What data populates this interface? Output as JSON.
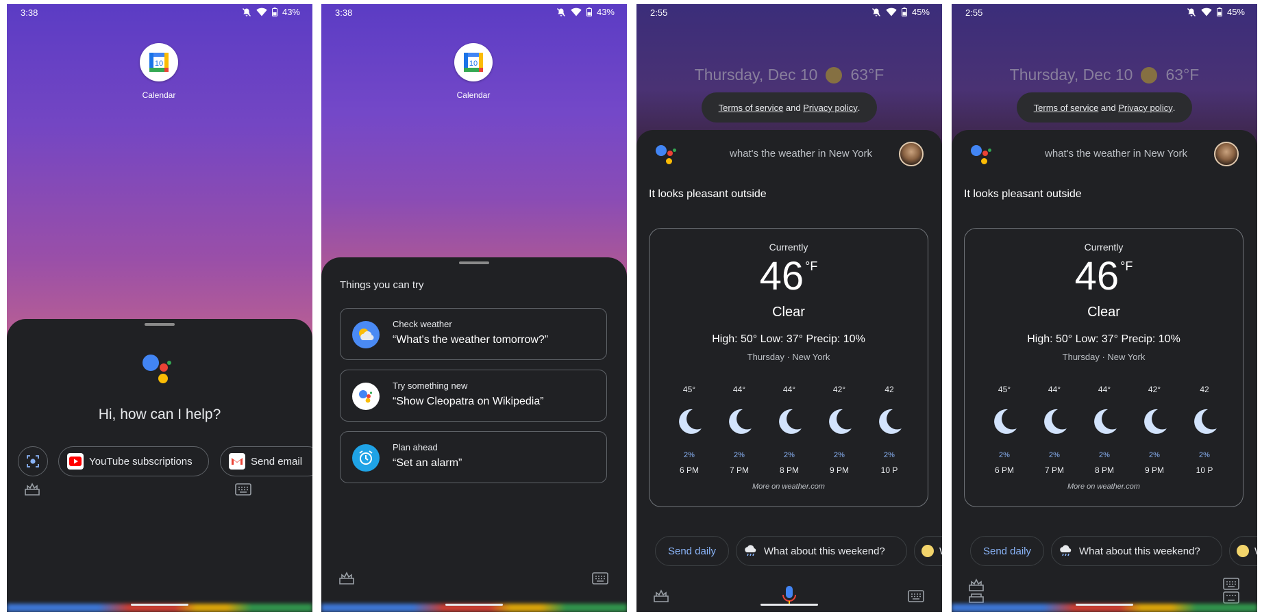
{
  "status": {
    "phone1": {
      "time": "3:38",
      "battery": "43%"
    },
    "phone2": {
      "time": "3:38",
      "battery": "43%"
    },
    "phone3": {
      "time": "2:55",
      "battery": "45%"
    },
    "phone4": {
      "time": "2:55",
      "battery": "45%"
    }
  },
  "home": {
    "app_label": "Calendar",
    "app_badge": "10"
  },
  "assistant_home": {
    "greeting": "Hi, how can I help?",
    "chips": [
      "YouTube subscriptions",
      "Send email"
    ]
  },
  "things_to_try": {
    "title": "Things you can try",
    "cards": [
      {
        "caption": "Check weather",
        "query": "“What's the weather tomorrow?”",
        "icon": "weather-icon"
      },
      {
        "caption": "Try something new",
        "query": "“Show Cleopatra on Wikipedia”",
        "icon": "assistant-icon"
      },
      {
        "caption": "Plan ahead",
        "query": "“Set an alarm”",
        "icon": "alarm-icon"
      }
    ]
  },
  "weather_screen": {
    "date": "Thursday, Dec 10",
    "date_temp": "63°F",
    "terms_tos": "Terms of service",
    "terms_and": " and ",
    "terms_pp": "Privacy policy",
    "terms_end": ".",
    "query": "what's the weather in New York",
    "response": "It looks pleasant outside",
    "currently": "Currently",
    "temp": "46",
    "unit": "°F",
    "condition": "Clear",
    "high_low": "High: 50° Low: 37° Precip: 10%",
    "location": "Thursday · New York",
    "hourly": [
      {
        "temp": "45°",
        "precip": "2%",
        "hour": "6 PM"
      },
      {
        "temp": "44°",
        "precip": "2%",
        "hour": "7 PM"
      },
      {
        "temp": "44°",
        "precip": "2%",
        "hour": "8 PM"
      },
      {
        "temp": "42°",
        "precip": "2%",
        "hour": "9 PM"
      },
      {
        "temp": "42",
        "precip": "2%",
        "hour": "10 P"
      }
    ],
    "more": "More on weather.com",
    "suggestions": [
      "Send daily",
      "What about this weekend?",
      "W"
    ]
  },
  "colors": {
    "google_blue": "#4285f4",
    "google_red": "#ea4335",
    "google_yellow": "#fbbc05",
    "google_green": "#34a853",
    "link_blue": "#8ab4f8",
    "sheet_bg": "#202124"
  }
}
